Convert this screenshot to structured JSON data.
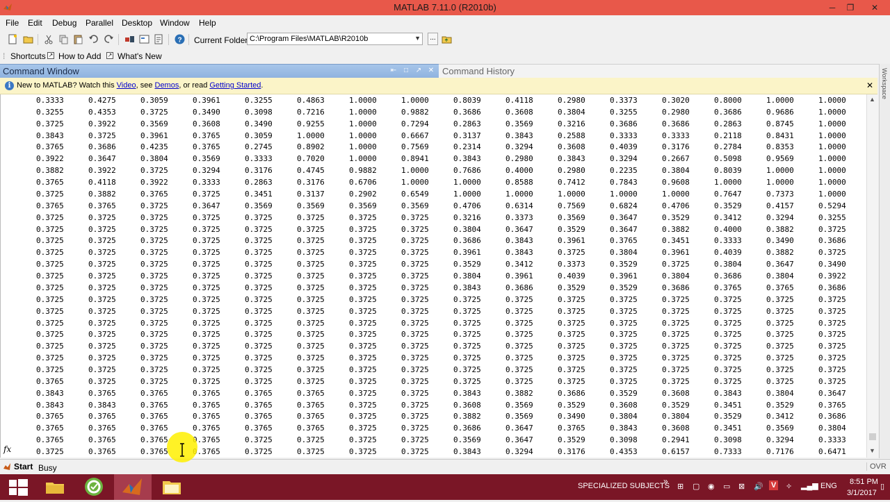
{
  "window": {
    "title": "MATLAB  7.11.0 (R2010b)",
    "min": "─",
    "max": "❐",
    "close": "✕"
  },
  "menu": [
    "File",
    "Edit",
    "Debug",
    "Parallel",
    "Desktop",
    "Window",
    "Help"
  ],
  "toolbar": {
    "current_folder_label": "Current Folder:",
    "current_folder": "C:\\Program Files\\MATLAB\\R2010b",
    "browse": "..."
  },
  "shortcuts": {
    "label": "Shortcuts",
    "how_to_add": "How to Add",
    "whats_new": "What's New"
  },
  "command_window": {
    "title": "Command Window"
  },
  "command_history": {
    "title": "Command History"
  },
  "workspace_tab": "Workspace",
  "info_bar": {
    "pre": "New to MATLAB? Watch this ",
    "video": "Video",
    "mid1": ", see ",
    "demos": "Demos",
    "mid2": ", or read ",
    "getting_started": "Getting Started",
    "post": "."
  },
  "prompt_symbol": "fx",
  "matrix": [
    [
      "0.3333",
      "0.4275",
      "0.3059",
      "0.3961",
      "0.3255",
      "0.4863",
      "1.0000",
      "1.0000",
      "0.8039",
      "0.4118",
      "0.2980",
      "0.3373",
      "0.3020",
      "0.8000",
      "1.0000",
      "1.0000"
    ],
    [
      "0.3255",
      "0.4353",
      "0.3725",
      "0.3490",
      "0.3098",
      "0.7216",
      "1.0000",
      "0.9882",
      "0.3686",
      "0.3608",
      "0.3804",
      "0.3255",
      "0.2980",
      "0.3686",
      "0.9686",
      "1.0000"
    ],
    [
      "0.3725",
      "0.3922",
      "0.3569",
      "0.3608",
      "0.3490",
      "0.9255",
      "1.0000",
      "0.7294",
      "0.2863",
      "0.3569",
      "0.3216",
      "0.3686",
      "0.3686",
      "0.2863",
      "0.8745",
      "1.0000"
    ],
    [
      "0.3843",
      "0.3725",
      "0.3961",
      "0.3765",
      "0.3059",
      "1.0000",
      "1.0000",
      "0.6667",
      "0.3137",
      "0.3843",
      "0.2588",
      "0.3333",
      "0.3333",
      "0.2118",
      "0.8431",
      "1.0000"
    ],
    [
      "0.3765",
      "0.3686",
      "0.4235",
      "0.3765",
      "0.2745",
      "0.8902",
      "1.0000",
      "0.7569",
      "0.2314",
      "0.3294",
      "0.3608",
      "0.4039",
      "0.3176",
      "0.2784",
      "0.8353",
      "1.0000"
    ],
    [
      "0.3922",
      "0.3647",
      "0.3804",
      "0.3569",
      "0.3333",
      "0.7020",
      "1.0000",
      "0.8941",
      "0.3843",
      "0.2980",
      "0.3843",
      "0.3294",
      "0.2667",
      "0.5098",
      "0.9569",
      "1.0000"
    ],
    [
      "0.3882",
      "0.3922",
      "0.3725",
      "0.3294",
      "0.3176",
      "0.4745",
      "0.9882",
      "1.0000",
      "0.7686",
      "0.4000",
      "0.2980",
      "0.2235",
      "0.3804",
      "0.8039",
      "1.0000",
      "1.0000"
    ],
    [
      "0.3765",
      "0.4118",
      "0.3922",
      "0.3333",
      "0.2863",
      "0.3176",
      "0.6706",
      "1.0000",
      "1.0000",
      "0.8588",
      "0.7412",
      "0.7843",
      "0.9608",
      "1.0000",
      "1.0000",
      "1.0000"
    ],
    [
      "0.3725",
      "0.3882",
      "0.3765",
      "0.3725",
      "0.3451",
      "0.3137",
      "0.2902",
      "0.6549",
      "1.0000",
      "1.0000",
      "1.0000",
      "1.0000",
      "1.0000",
      "0.7647",
      "0.7373",
      "1.0000"
    ],
    [
      "0.3765",
      "0.3765",
      "0.3725",
      "0.3647",
      "0.3569",
      "0.3569",
      "0.3569",
      "0.3569",
      "0.4706",
      "0.6314",
      "0.7569",
      "0.6824",
      "0.4706",
      "0.3529",
      "0.4157",
      "0.5294"
    ],
    [
      "0.3725",
      "0.3725",
      "0.3725",
      "0.3725",
      "0.3725",
      "0.3725",
      "0.3725",
      "0.3725",
      "0.3216",
      "0.3373",
      "0.3569",
      "0.3647",
      "0.3529",
      "0.3412",
      "0.3294",
      "0.3255"
    ],
    [
      "0.3725",
      "0.3725",
      "0.3725",
      "0.3725",
      "0.3725",
      "0.3725",
      "0.3725",
      "0.3725",
      "0.3804",
      "0.3647",
      "0.3529",
      "0.3647",
      "0.3882",
      "0.4000",
      "0.3882",
      "0.3725"
    ],
    [
      "0.3725",
      "0.3725",
      "0.3725",
      "0.3725",
      "0.3725",
      "0.3725",
      "0.3725",
      "0.3725",
      "0.3686",
      "0.3843",
      "0.3961",
      "0.3765",
      "0.3451",
      "0.3333",
      "0.3490",
      "0.3686"
    ],
    [
      "0.3725",
      "0.3725",
      "0.3725",
      "0.3725",
      "0.3725",
      "0.3725",
      "0.3725",
      "0.3725",
      "0.3961",
      "0.3843",
      "0.3725",
      "0.3804",
      "0.3961",
      "0.4039",
      "0.3882",
      "0.3725"
    ],
    [
      "0.3725",
      "0.3725",
      "0.3725",
      "0.3725",
      "0.3725",
      "0.3725",
      "0.3725",
      "0.3725",
      "0.3529",
      "0.3412",
      "0.3373",
      "0.3529",
      "0.3725",
      "0.3804",
      "0.3647",
      "0.3490"
    ],
    [
      "0.3725",
      "0.3725",
      "0.3725",
      "0.3725",
      "0.3725",
      "0.3725",
      "0.3725",
      "0.3725",
      "0.3804",
      "0.3961",
      "0.4039",
      "0.3961",
      "0.3804",
      "0.3686",
      "0.3804",
      "0.3922"
    ],
    [
      "0.3725",
      "0.3725",
      "0.3725",
      "0.3725",
      "0.3725",
      "0.3725",
      "0.3725",
      "0.3725",
      "0.3843",
      "0.3686",
      "0.3529",
      "0.3529",
      "0.3686",
      "0.3765",
      "0.3765",
      "0.3686"
    ],
    [
      "0.3725",
      "0.3725",
      "0.3725",
      "0.3725",
      "0.3725",
      "0.3725",
      "0.3725",
      "0.3725",
      "0.3725",
      "0.3725",
      "0.3725",
      "0.3725",
      "0.3725",
      "0.3725",
      "0.3725",
      "0.3725"
    ],
    [
      "0.3725",
      "0.3725",
      "0.3725",
      "0.3725",
      "0.3725",
      "0.3725",
      "0.3725",
      "0.3725",
      "0.3725",
      "0.3725",
      "0.3725",
      "0.3725",
      "0.3725",
      "0.3725",
      "0.3725",
      "0.3725"
    ],
    [
      "0.3725",
      "0.3725",
      "0.3725",
      "0.3725",
      "0.3725",
      "0.3725",
      "0.3725",
      "0.3725",
      "0.3725",
      "0.3725",
      "0.3725",
      "0.3725",
      "0.3725",
      "0.3725",
      "0.3725",
      "0.3725"
    ],
    [
      "0.3725",
      "0.3725",
      "0.3725",
      "0.3725",
      "0.3725",
      "0.3725",
      "0.3725",
      "0.3725",
      "0.3725",
      "0.3725",
      "0.3725",
      "0.3725",
      "0.3725",
      "0.3725",
      "0.3725",
      "0.3725"
    ],
    [
      "0.3725",
      "0.3725",
      "0.3725",
      "0.3725",
      "0.3725",
      "0.3725",
      "0.3725",
      "0.3725",
      "0.3725",
      "0.3725",
      "0.3725",
      "0.3725",
      "0.3725",
      "0.3725",
      "0.3725",
      "0.3725"
    ],
    [
      "0.3725",
      "0.3725",
      "0.3725",
      "0.3725",
      "0.3725",
      "0.3725",
      "0.3725",
      "0.3725",
      "0.3725",
      "0.3725",
      "0.3725",
      "0.3725",
      "0.3725",
      "0.3725",
      "0.3725",
      "0.3725"
    ],
    [
      "0.3725",
      "0.3725",
      "0.3725",
      "0.3725",
      "0.3725",
      "0.3725",
      "0.3725",
      "0.3725",
      "0.3725",
      "0.3725",
      "0.3725",
      "0.3725",
      "0.3725",
      "0.3725",
      "0.3725",
      "0.3725"
    ],
    [
      "0.3765",
      "0.3725",
      "0.3725",
      "0.3725",
      "0.3725",
      "0.3725",
      "0.3725",
      "0.3725",
      "0.3725",
      "0.3725",
      "0.3725",
      "0.3725",
      "0.3725",
      "0.3725",
      "0.3725",
      "0.3725"
    ],
    [
      "0.3843",
      "0.3765",
      "0.3765",
      "0.3765",
      "0.3765",
      "0.3765",
      "0.3725",
      "0.3725",
      "0.3843",
      "0.3882",
      "0.3686",
      "0.3529",
      "0.3608",
      "0.3843",
      "0.3804",
      "0.3647"
    ],
    [
      "0.3843",
      "0.3843",
      "0.3765",
      "0.3765",
      "0.3765",
      "0.3765",
      "0.3725",
      "0.3725",
      "0.3608",
      "0.3569",
      "0.3529",
      "0.3608",
      "0.3529",
      "0.3451",
      "0.3529",
      "0.3765"
    ],
    [
      "0.3765",
      "0.3765",
      "0.3765",
      "0.3765",
      "0.3765",
      "0.3765",
      "0.3725",
      "0.3725",
      "0.3882",
      "0.3569",
      "0.3490",
      "0.3804",
      "0.3804",
      "0.3529",
      "0.3412",
      "0.3686"
    ],
    [
      "0.3765",
      "0.3765",
      "0.3765",
      "0.3765",
      "0.3765",
      "0.3765",
      "0.3725",
      "0.3725",
      "0.3686",
      "0.3647",
      "0.3765",
      "0.3843",
      "0.3608",
      "0.3451",
      "0.3569",
      "0.3804"
    ],
    [
      "0.3765",
      "0.3765",
      "0.3765",
      "0.3765",
      "0.3725",
      "0.3725",
      "0.3725",
      "0.3725",
      "0.3569",
      "0.3647",
      "0.3529",
      "0.3098",
      "0.2941",
      "0.3098",
      "0.3294",
      "0.3333"
    ],
    [
      "0.3725",
      "0.3765",
      "0.3765",
      "0.3765",
      "0.3725",
      "0.3725",
      "0.3725",
      "0.3725",
      "0.3843",
      "0.3294",
      "0.3176",
      "0.4353",
      "0.6157",
      "0.7333",
      "0.7176",
      "0.6471"
    ]
  ],
  "status": {
    "start": "Start",
    "state": "Busy",
    "ovr": "OVR"
  },
  "taskbar": {
    "toolbar_label": "SPECIALIZED SUBJECTS",
    "chevron": "»",
    "language": "ENG",
    "time": "8:51 PM",
    "date": "3/1/2017"
  },
  "colors": {
    "titlebar": "#e8584a",
    "taskbar": "#7a1626",
    "cw_header": "#9bbce5",
    "info_bar": "#fbf4c8"
  }
}
